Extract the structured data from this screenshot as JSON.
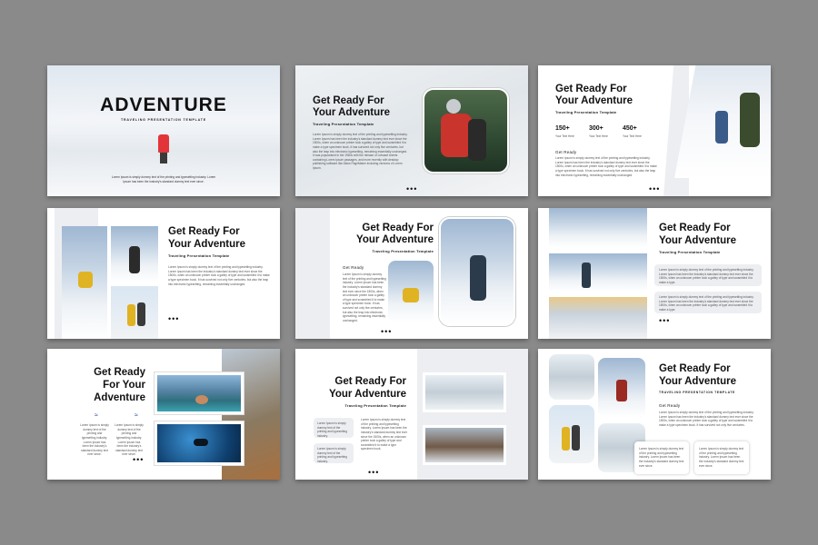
{
  "s1": {
    "title": "ADVENTURE",
    "sub": "TRAVELING PRESENTATION TEMPLATE",
    "body": "Lorem Ipsum is simply dummy text of the printing and typesetting industry. Lorem Ipsum has been the industry's standard dummy text ever since."
  },
  "s2": {
    "title1": "Get Ready For",
    "title2": "Your Adventure",
    "sub": "Traveling Presentation Template",
    "body": "Lorem Ipsum is simply dummy text of the printing and typesetting industry. Lorem Ipsum has been the industry's standard dummy text ever since the 1500s, when an unknown printer took a galley of type and scrambled it to make a type specimen book. It has survived not only five centuries, but also the leap into electronic typesetting, remaining essentially unchanged. It was popularised in the 1960s with the release of Letraset sheets containing Lorem Ipsum passages, and more recently with desktop publishing software like Aldus PageMaker including versions of Lorem Ipsum.",
    "dots": "•••"
  },
  "s3": {
    "title1": "Get Ready For",
    "title2": "Your Adventure",
    "sub": "Traveling Presentation Template",
    "stats": [
      {
        "value": "150+",
        "label": "Your Text Here"
      },
      {
        "value": "300+",
        "label": "Your Text Here"
      },
      {
        "value": "450+",
        "label": "Your Text Here"
      }
    ],
    "heading": "Get Ready",
    "body": "Lorem Ipsum is simply dummy text of the printing and typesetting industry. Lorem Ipsum has been the industry's standard dummy text ever since the 1500s, when an unknown printer took a galley of type and scrambled it to make a type specimen book. It has survived not only five centuries, but also the leap into electronic typesetting, remaining essentially unchanged.",
    "dots": "•••"
  },
  "s4": {
    "title1": "Get Ready For",
    "title2": "Your Adventure",
    "sub": "Traveling Presentation Template",
    "body": "Lorem Ipsum is simply dummy text of the printing and typesetting industry. Lorem Ipsum has been the industry's standard dummy text ever since the 1500s, when an unknown printer took a galley of type and scrambled it to make a type specimen book. It has survived not only five centuries, but also the leap into electronic typesetting, remaining essentially unchanged.",
    "dots": "•••"
  },
  "s5": {
    "title1": "Get Ready For",
    "title2": "Your Adventure",
    "sub": "Traveling Presentation Template",
    "heading": "Get Ready",
    "body": "Lorem Ipsum is simply dummy text of the printing and typesetting industry. Lorem Ipsum has been the industry's standard dummy text ever since the 1500s, when an unknown printer took a galley of type and scrambled it to make a type specimen book. It has survived not only five centuries, but also the leap into electronic typesetting, remaining essentially unchanged.",
    "dots": "•••"
  },
  "s6": {
    "title1": "Get Ready For",
    "title2": "Your Adventure",
    "sub": "Traveling Presentation Template",
    "box1": "Lorem Ipsum is simply dummy text of the printing and typesetting industry. Lorem Ipsum has been the industry's standard dummy text ever since the 1500s, when an unknown printer took a galley of type and scrambled it to make a type.",
    "box2": "Lorem Ipsum is simply dummy text of the printing and typesetting industry. Lorem Ipsum has been the industry's standard dummy text ever since the 1500s, when an unknown printer took a galley of type and scrambled it to make a type.",
    "dots": "•••"
  },
  "s7": {
    "title1": "Get Ready",
    "title2": "For Your",
    "title3": "Adventure",
    "col1": "Lorem Ipsum is simply dummy text of the printing and typesetting industry. Lorem Ipsum has been the industry's standard dummy text ever since.",
    "col2": "Lorem Ipsum is simply dummy text of the printing and typesetting industry. Lorem Ipsum has been the industry's standard dummy text ever since.",
    "dots": "•••"
  },
  "s8": {
    "title1": "Get Ready For",
    "title2": "Your Adventure",
    "sub": "Traveling Presentation Template",
    "box1": "Lorem Ipsum is simply dummy text of the printing and typesetting industry.",
    "box2": "Lorem Ipsum is simply dummy text of the printing and typesetting industry.",
    "body": "Lorem Ipsum is simply dummy text of the printing and typesetting industry. Lorem Ipsum has been the industry's standard dummy text ever since the 1500s, when an unknown printer took a galley of type and scrambled it to make a type specimen book.",
    "dots": "•••"
  },
  "s9": {
    "title1": "Get Ready For",
    "title2": "Your Adventure",
    "sub": "TRAVELING PRESENTATION TEMPLATE",
    "heading": "Get Ready",
    "body": "Lorem Ipsum is simply dummy text of the printing and typesetting industry. Lorem Ipsum has been the industry's standard dummy text ever since the 1500s, when an unknown printer took a galley of type and scrambled it to make a type specimen book. It has survived not only five centuries.",
    "box1": "Lorem Ipsum is simply dummy text of the printing and typesetting industry. Lorem Ipsum has been the industry's standard dummy text ever since.",
    "box2": "Lorem Ipsum is simply dummy text of the printing and typesetting industry. Lorem Ipsum has been the industry's standard dummy text ever since."
  }
}
